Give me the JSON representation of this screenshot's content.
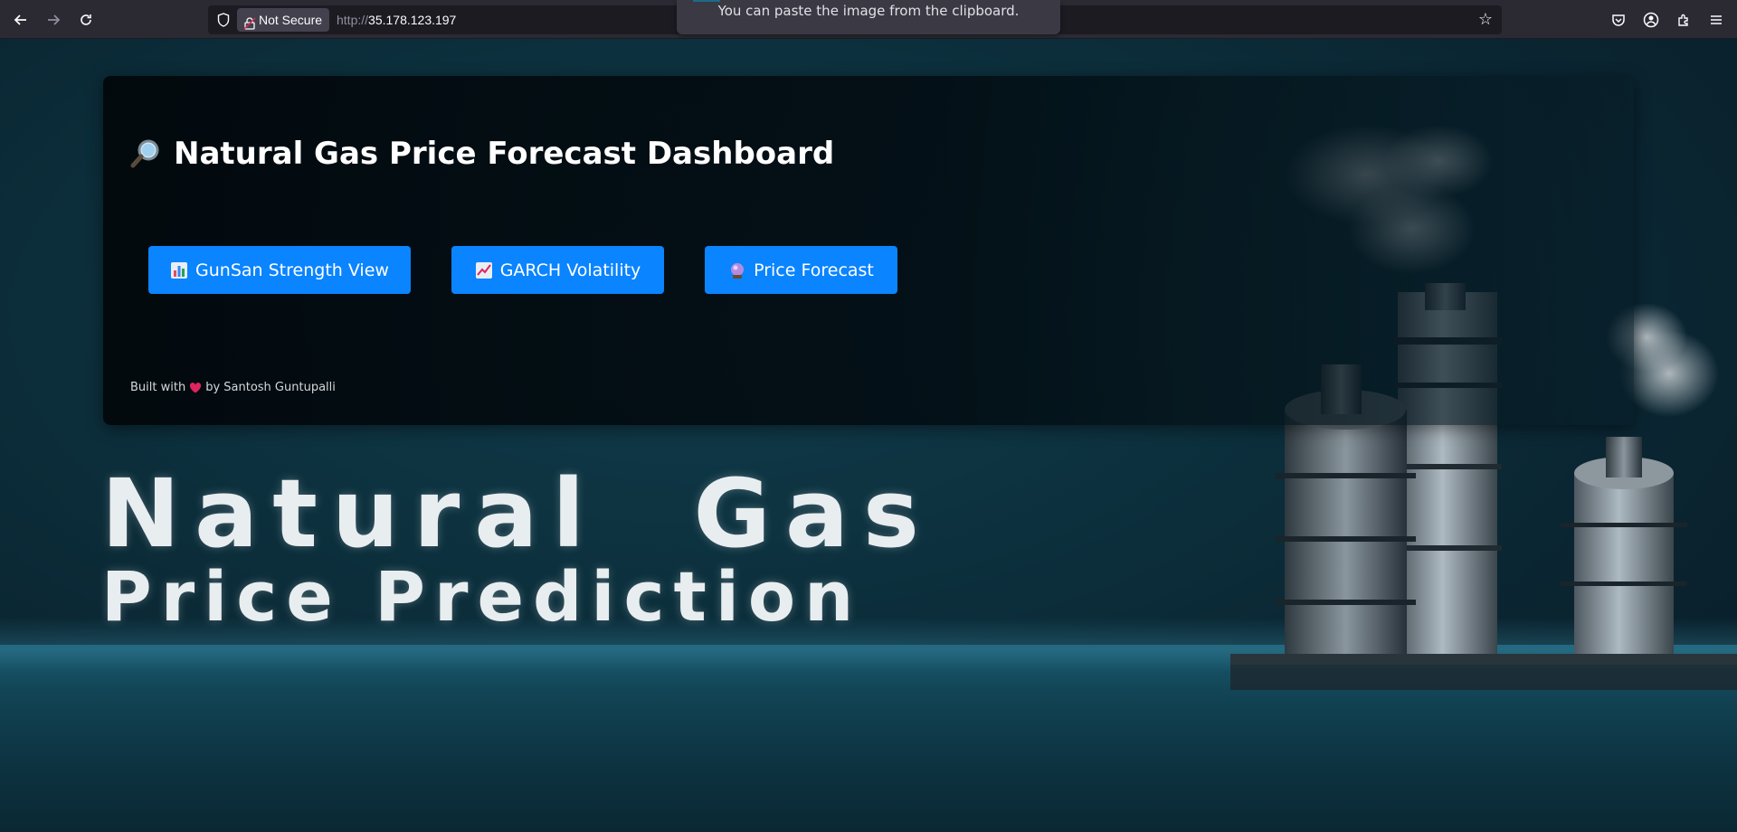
{
  "browser": {
    "security_label": "Not Secure",
    "url_scheme": "http://",
    "url_host": "35.178.123.197",
    "toast": "You can paste the image from the clipboard."
  },
  "dashboard": {
    "title": "Natural Gas Price Forecast Dashboard",
    "title_icon": "magnifier-icon",
    "buttons": [
      {
        "label": "GunSan Strength View",
        "icon": "bar-chart-icon"
      },
      {
        "label": "GARCH Volatility",
        "icon": "trend-chart-icon"
      },
      {
        "label": "Price Forecast",
        "icon": "crystal-ball-icon"
      }
    ],
    "footer_prefix": "Built with",
    "footer_suffix": "by Santosh Guntupalli",
    "footer_icon": "heart-icon"
  },
  "hero": {
    "line1": "Natural  Gas",
    "line2": "Price Prediction"
  },
  "colors": {
    "button_bg": "#0a84ff",
    "background": "#0c2f3c",
    "heart": "#e0245e"
  }
}
